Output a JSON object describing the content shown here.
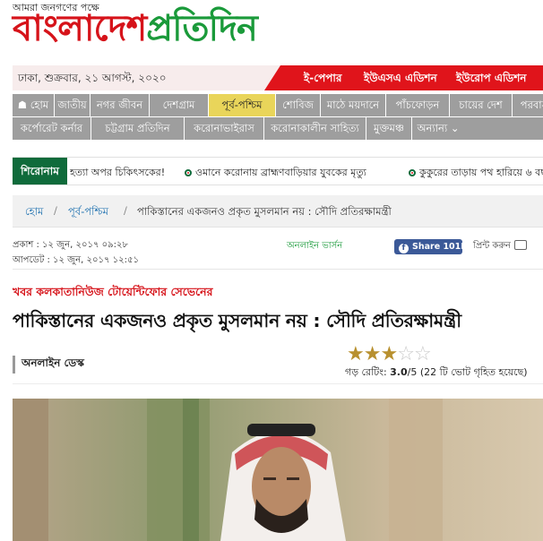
{
  "header": {
    "tagline": "আমরা জনগণের পক্ষে",
    "logo_part1": "বাংলাদেশ",
    "logo_part2": "প্রতিদিন"
  },
  "datebar": {
    "date": "ঢাকা, শুক্রবার, ২১ আগস্ট, ২০২০",
    "editions": [
      "ই-পেপার",
      "ইউএসএ এডিশন",
      "ইউরোপ এডিশন"
    ]
  },
  "nav": {
    "row1": [
      "হোম",
      "জাতীয়",
      "নগর জীবন",
      "দেশগ্রাম",
      "পূর্ব-পশ্চিম",
      "শোবিজ",
      "মাঠে ময়দানে",
      "পাঁচফোড়ন",
      "চায়ের দেশ",
      "পরবাস"
    ],
    "row2": [
      "কর্পোরেট কর্নার",
      "চট্টগ্রাম প্রতিদিন",
      "করোনাভাইরাস",
      "করোনাকালীন সাহিত্য",
      "মুক্তমঞ্চ",
      "অন্যান্য"
    ],
    "active": "পূর্ব-পশ্চিম"
  },
  "ticker": {
    "label": "শিরোনাম",
    "items": [
      "হত্যা অপর চিকিৎসকের!",
      "ওমানে করোনায় ব্রাহ্মণবাড়িয়ার যুবকের মৃত্যু",
      "কুকুরের তাড়ায় পথ হারিয়ে ৬ বছ"
    ]
  },
  "breadcrumb": {
    "home": "হোম",
    "section": "পূর্ব-পশ্চিম",
    "current": "পাকিস্তানের একজনও প্রকৃত মুসলমান নয় : সৌদি প্রতিরক্ষামন্ত্রী",
    "separator": "/"
  },
  "meta": {
    "published": "প্রকাশ : ১২ জুন, ২০১৭ ০৯:২৮",
    "updated": "আপডেট : ১২ জুন, ২০১৭ ১২:৫১",
    "online_version": "অনলাইন ভার্সন",
    "share_label": "Share 101K",
    "print_label": "প্রিন্ট করুন"
  },
  "article": {
    "kicker": "খবর কলকাতানিউজ টোয়েন্টিফোর সেভেনের",
    "headline": "পাকিস্তানের একজনও প্রকৃত মুসলমান নয় : সৌদি প্রতিরক্ষামন্ত্রী",
    "author": "অনলাইন ডেস্ক",
    "rating": {
      "stars": 3,
      "max": 5,
      "prefix": "গড় রেটিং:",
      "value": "3.0",
      "suffix": "/5 (22 টি ভোট গৃহিত হয়েছে)"
    }
  },
  "colors": {
    "brand_red": "#d6131a",
    "brand_green": "#1a9a3a",
    "nav_bg": "#9e9e9e",
    "nav_active": "#e9d55a",
    "ticker_label": "#0f6b3b",
    "share_blue": "#3b5998"
  }
}
